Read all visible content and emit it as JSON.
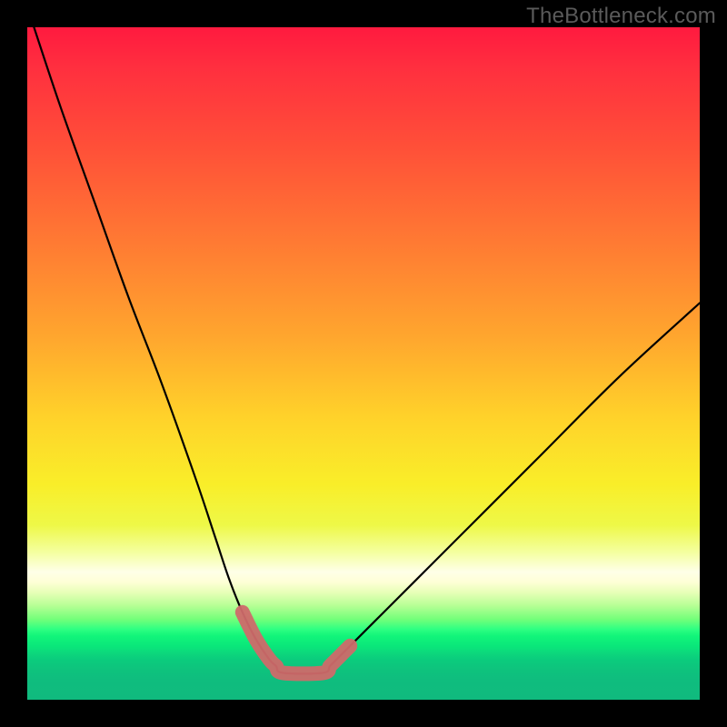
{
  "watermark": "TheBottleneck.com",
  "chart_data": {
    "type": "line",
    "title": "",
    "xlabel": "",
    "ylabel": "",
    "ylim": [
      0,
      100
    ],
    "xlim": [
      0,
      100
    ],
    "series": [
      {
        "name": "bottleneck-curve",
        "x": [
          1,
          5,
          10,
          15,
          20,
          25,
          28,
          30,
          32,
          34,
          36,
          37,
          38,
          44,
          45,
          46,
          48,
          52,
          58,
          66,
          76,
          88,
          100
        ],
        "values": [
          100,
          88,
          74,
          60,
          47,
          33,
          24,
          18,
          13,
          9,
          6,
          5,
          4,
          4,
          5,
          6,
          8,
          12,
          18,
          26,
          36,
          48,
          59
        ]
      }
    ],
    "highlight_segment": {
      "name": "valley-highlight",
      "x": [
        32,
        34,
        36,
        37,
        38,
        44,
        45,
        46,
        48
      ],
      "values": [
        13,
        9,
        6,
        5,
        4,
        4,
        5,
        6,
        8
      ],
      "color": "#cf6a6a"
    },
    "gradient_stops": [
      {
        "pos": 0,
        "color": "#ff1a3f"
      },
      {
        "pos": 46,
        "color": "#ffa62e"
      },
      {
        "pos": 68,
        "color": "#f9ee29"
      },
      {
        "pos": 82,
        "color": "#feffd6"
      },
      {
        "pos": 90,
        "color": "#12f57a"
      },
      {
        "pos": 100,
        "color": "#10ba7e"
      }
    ]
  }
}
